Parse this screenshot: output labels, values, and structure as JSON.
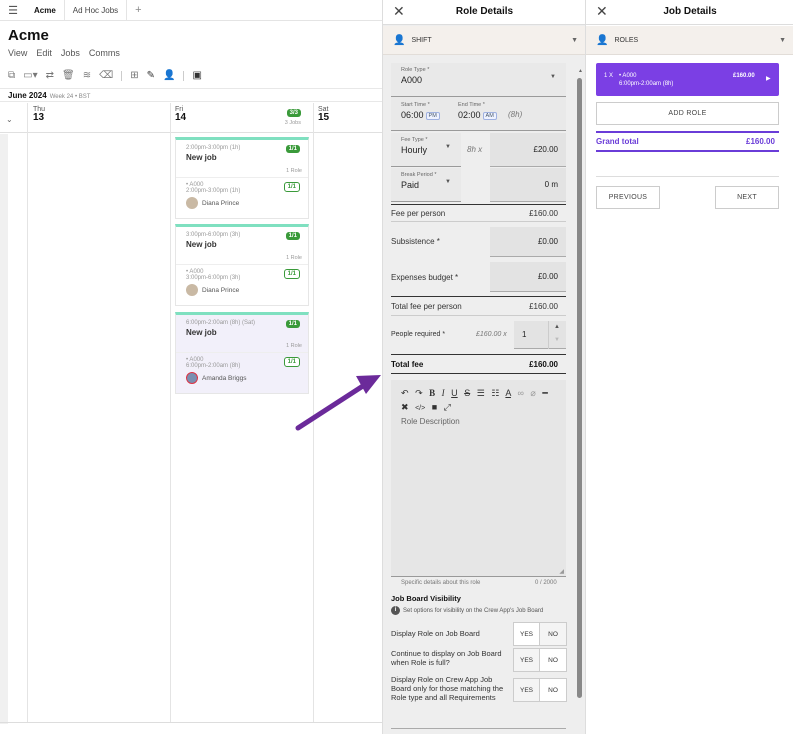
{
  "app": {
    "tabs": [
      "Acme",
      "Ad Hoc Jobs"
    ],
    "tab_add": "+",
    "title": "Acme",
    "menus": [
      "View",
      "Edit",
      "Jobs",
      "Comms"
    ],
    "month": "June 2024",
    "week": "Week 24 • BST",
    "days": [
      {
        "dow": "Thu",
        "num": "13"
      },
      {
        "dow": "Fri",
        "num": "14",
        "badge": "3/3",
        "jobs": "3 Jobs"
      },
      {
        "dow": "Sat",
        "num": "15"
      }
    ],
    "cards": [
      {
        "time": "2:00pm-3:00pm (1h)",
        "job": "New job",
        "badge": "1/1",
        "roles": "1 Role",
        "role": "• A000",
        "role_time": "2:00pm-3:00pm (1h)",
        "role_badge": "1/1",
        "person": "Diana Prince"
      },
      {
        "time": "3:00pm-6:00pm (3h)",
        "job": "New job",
        "badge": "1/1",
        "roles": "1 Role",
        "role": "• A000",
        "role_time": "3:00pm-6:00pm (3h)",
        "role_badge": "1/1",
        "person": "Diana Prince"
      },
      {
        "time": "6:00pm-2:00am (8h) (Sat)",
        "job": "New job",
        "badge": "1/1",
        "roles": "1 Role",
        "role": "• A000",
        "role_time": "6:00pm-2:00am (8h)",
        "role_badge": "1/1",
        "person": "Amanda Briggs"
      }
    ]
  },
  "role_details": {
    "title": "Role Details",
    "section": "SHIFT",
    "role_type_label": "Role Type *",
    "role_type_value": "A000",
    "start_label": "Start Time *",
    "start_value": "06:00",
    "start_ampm": "PM",
    "end_label": "End Time *",
    "end_value": "02:00",
    "end_ampm": "AM",
    "duration": "(8h)",
    "fee_type_label": "Fee Type *",
    "fee_type_value": "Hourly",
    "fee_mult": "8h x",
    "fee_value": "£20.00",
    "break_label": "Break Period *",
    "break_value": "Paid",
    "break_minutes": "0 m",
    "fee_per_person_label": "Fee per person",
    "fee_per_person_value": "£160.00",
    "subsistence_label": "Subsistence *",
    "subsistence_value": "£0.00",
    "expenses_label": "Expenses budget *",
    "expenses_value": "£0.00",
    "total_fee_pp_label": "Total fee per person",
    "total_fee_pp_value": "£160.00",
    "people_label": "People required *",
    "people_mult": "£160.00 x",
    "people_value": "1",
    "total_fee_label": "Total fee",
    "total_fee_value": "£160.00",
    "description_placeholder": "Role Description",
    "description_hint": "Specific details about this role",
    "description_count": "0 / 2000",
    "visibility_title": "Job Board Visibility",
    "visibility_info": "Set options for visibility on the Crew App's Job Board",
    "q1": "Display Role on Job Board",
    "q2": "Continue to display on Job Board when Role is full?",
    "q3": "Display Role on Crew App Job Board only for those matching the Role type and all Requirements",
    "yes": "YES",
    "no": "NO"
  },
  "job_details": {
    "title": "Job Details",
    "section": "ROLES",
    "role_chip_qty": "1 X",
    "role_chip_name": "• A000",
    "role_chip_time": "6:00pm-2:00am (8h)",
    "role_chip_price": "£160.00",
    "add_role": "ADD ROLE",
    "grand_total_label": "Grand total",
    "grand_total_value": "£160.00",
    "previous": "PREVIOUS",
    "next": "NEXT"
  },
  "colors": {
    "accent": "#7b3fe4",
    "success": "#3a9a3a",
    "card_top": "#7fe0c0",
    "arrow": "#6b2a9a"
  }
}
